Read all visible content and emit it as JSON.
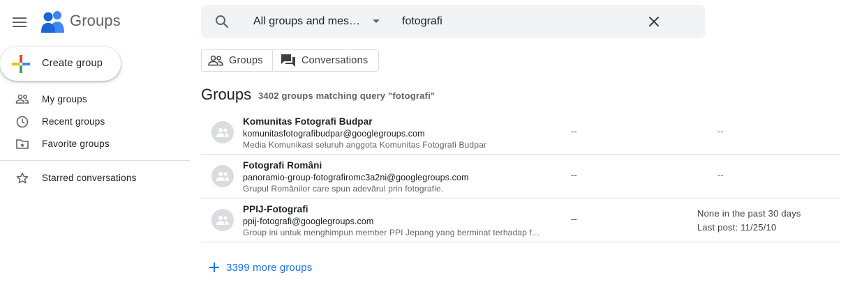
{
  "app": {
    "title": "Groups"
  },
  "sidebar": {
    "create_label": "Create group",
    "items": [
      {
        "label": "My groups",
        "icon": "people-icon"
      },
      {
        "label": "Recent groups",
        "icon": "clock-icon"
      },
      {
        "label": "Favorite groups",
        "icon": "folder-star-icon"
      },
      {
        "label": "Starred conversations",
        "icon": "star-icon"
      }
    ]
  },
  "search": {
    "scope": "All groups and messages",
    "query": "fotografi"
  },
  "toggle": {
    "groups_label": "Groups",
    "conversations_label": "Conversations"
  },
  "results": {
    "title": "Groups",
    "count_text": "3402 groups matching query \"fotografi\"",
    "rows": [
      {
        "name": "Komunitas Fotografi Budpar",
        "email": "komunitasfotografibudpar@googlegroups.com",
        "description": "Media Komunikasi seluruh anggota Komunitas Fotografi Budpar",
        "col1": "--",
        "col2": "--"
      },
      {
        "name": "Fotografi Români",
        "email": "panoramio-group-fotografiromc3a2ni@googlegroups.com",
        "description": "Grupul Românilor care spun adevărul prin fotografie.",
        "col1": "--",
        "col2": "--"
      },
      {
        "name": "PPIJ-Fotografi",
        "email": "ppij-fotografi@googlegroups.com",
        "description": "Group ini untuk menghimpun member PPI Jepang yang berminat terhadap fotografi",
        "col1": "--",
        "activity": "None in the past 30 days",
        "last_post": "Last post: 11/25/10"
      }
    ],
    "more_label": "3399 more groups"
  },
  "colors": {
    "accent_blue": "#1a73e8",
    "google_blue": "#4285f4",
    "google_red": "#ea4335",
    "google_yellow": "#fbbc04",
    "google_green": "#34a853",
    "search_bg": "#f1f3f4",
    "divider": "#dadce0"
  }
}
